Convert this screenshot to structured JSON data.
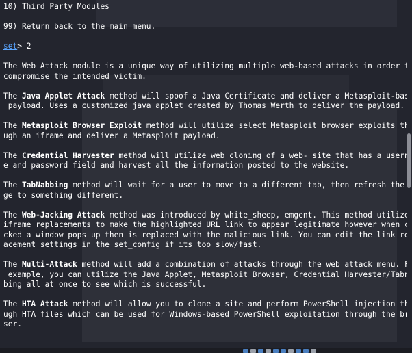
{
  "terminal": {
    "menu": {
      "item_third_party": "10) Third Party Modules",
      "item_return": "99) Return back to the main menu."
    },
    "prompt": {
      "label": "set",
      "suffix": "> 2"
    },
    "intro": [
      "The Web Attack module is a unique way of utilizing multiple web-based attacks in order to",
      "compromise the intended victim."
    ],
    "java": {
      "pre": "The ",
      "name": "Java Applet Attack",
      "post": " method will spoof a Java Certificate and deliver a Metasploit-based",
      "rest": [
        " payload. Uses a customized java applet created by Thomas Werth to deliver the payload."
      ]
    },
    "browser": {
      "pre": "The ",
      "name": "Metasploit Browser Exploit",
      "post": " method will utilize select Metasploit browser exploits thro",
      "rest": [
        "ugh an iframe and deliver a Metasploit payload."
      ]
    },
    "harvester": {
      "pre": "The ",
      "name": "Credential Harvester",
      "post": " method will utilize web cloning of a web- site that has a usernam",
      "rest": [
        "e and password field and harvest all the information posted to the website."
      ]
    },
    "tabnabbing": {
      "pre": "The ",
      "name": "TabNabbing",
      "post": " method will wait for a user to move to a different tab, then refresh the pa",
      "rest": [
        "ge to something different."
      ]
    },
    "webjacking": {
      "pre": "The ",
      "name": "Web-Jacking Attack",
      "post": " method was introduced by white_sheep, emgent. This method utilizes",
      "rest": [
        "iframe replacements to make the highlighted URL link to appear legitimate however when cli",
        "cked a window pops up then is replaced with the malicious link. You can edit the link repl",
        "acement settings in the set_config if its too slow/fast."
      ]
    },
    "multi": {
      "pre": "The ",
      "name": "Multi-Attack",
      "post": " method will add a combination of attacks through the web attack menu. For",
      "rest": [
        " example, you can utilize the Java Applet, Metasploit Browser, Credential Harvester/Tabnab",
        "bing all at once to see which is successful."
      ]
    },
    "hta": {
      "pre": "The ",
      "name": "HTA Attack",
      "post": " method will allow you to clone a site and perform PowerShell injection thro",
      "rest": [
        "ugh HTA files which can be used for Windows-based PowerShell exploitation through the brow",
        "ser."
      ]
    }
  },
  "colors": {
    "background": "#23252e",
    "text": "#ffffff",
    "prompt_link": "#59a5ff"
  }
}
